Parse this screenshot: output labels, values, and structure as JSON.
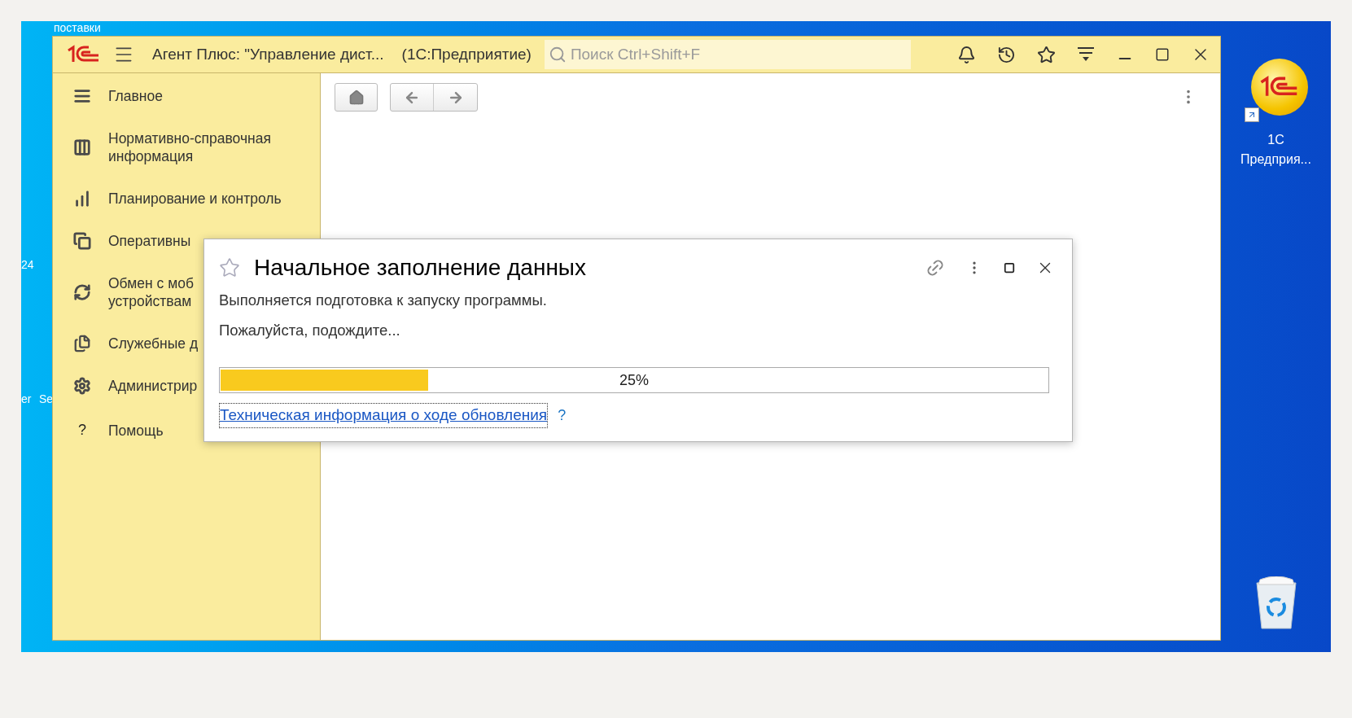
{
  "desktop": {
    "top_label": "поставки",
    "side_labels": [
      "24",
      "er",
      "Se"
    ],
    "icons": [
      {
        "kind": "app",
        "label": "1С Предприя..."
      },
      {
        "kind": "recycle"
      }
    ]
  },
  "window": {
    "title": "Агент Плюс: \"Управление дист...",
    "subtitle": "(1С:Предприятие)",
    "search": {
      "placeholder": "Поиск Ctrl+Shift+F"
    }
  },
  "sidebar": {
    "items": [
      {
        "kind": "menu",
        "label": "Главное"
      },
      {
        "kind": "grid",
        "label": "Нормативно-справочная информация"
      },
      {
        "kind": "chart",
        "label": "Планирование и контроль"
      },
      {
        "kind": "docs",
        "label": "Оперативны"
      },
      {
        "kind": "sync",
        "label": "Обмен с моб\nустройствам"
      },
      {
        "kind": "docs2",
        "label": "Служебные д"
      },
      {
        "kind": "gear",
        "label": "Администрир"
      },
      {
        "kind": "glyph",
        "glyph": "?",
        "label": "Помощь"
      }
    ]
  },
  "dialog": {
    "title": "Начальное заполнение данных",
    "lines": [
      "Выполняется подготовка к запуску программы.",
      "Пожалуйста, подождите..."
    ],
    "progress": {
      "level": 0.25,
      "reading": "25%"
    },
    "link": "Техническая информация о ходе обновления",
    "help": "?"
  }
}
